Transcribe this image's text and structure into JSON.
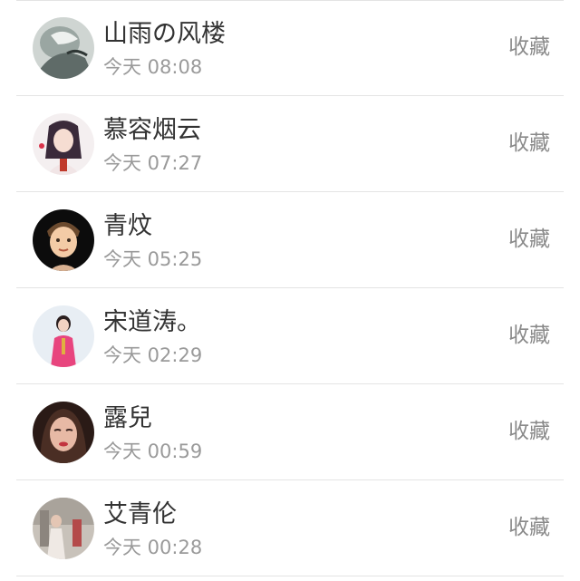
{
  "contacts": [
    {
      "name": "山雨の风楼",
      "time": "今天 08:08",
      "action": "收藏",
      "avatar": "avatar-ink-painting"
    },
    {
      "name": "慕容烟云",
      "time": "今天 07:27",
      "action": "收藏",
      "avatar": "avatar-anime-girl"
    },
    {
      "name": "青炆",
      "time": "今天 05:25",
      "action": "收藏",
      "avatar": "avatar-cartoon-boy"
    },
    {
      "name": "宋道涛。",
      "time": "今天 02:29",
      "action": "收藏",
      "avatar": "avatar-woman-pink-dress"
    },
    {
      "name": "露兒",
      "time": "今天 00:59",
      "action": "收藏",
      "avatar": "avatar-woman-portrait"
    },
    {
      "name": "艾青伦",
      "time": "今天 00:28",
      "action": "收藏",
      "avatar": "avatar-street-photo"
    }
  ]
}
